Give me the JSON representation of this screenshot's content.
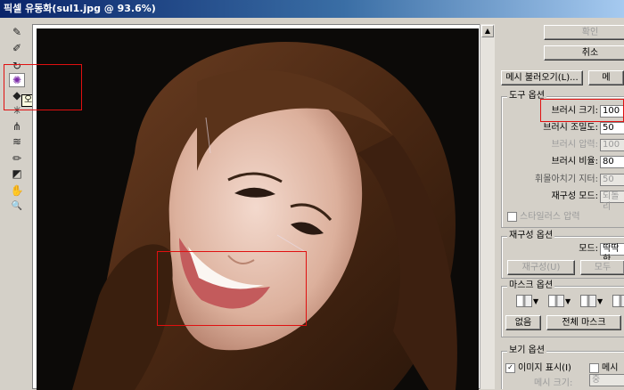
{
  "window": {
    "title": "픽셀 유동화(sul1.jpg @ 93.6%)"
  },
  "toolbar": {
    "tools": [
      {
        "icon": "forward-warp-icon",
        "glyph": "✎"
      },
      {
        "icon": "reconstruct-icon",
        "glyph": "✐"
      },
      {
        "icon": "twirl-icon",
        "glyph": "↻"
      },
      {
        "icon": "pucker-icon",
        "glyph": "✺"
      },
      {
        "icon": "bloat-icon",
        "glyph": "◆"
      },
      {
        "icon": "push-left-icon",
        "glyph": "✳"
      },
      {
        "icon": "mirror-icon",
        "glyph": "⋔"
      },
      {
        "icon": "turbulence-icon",
        "glyph": "≋"
      },
      {
        "icon": "freeze-mask-icon",
        "glyph": "✏"
      },
      {
        "icon": "thaw-mask-icon",
        "glyph": "◩"
      },
      {
        "icon": "hand-icon",
        "glyph": "✋"
      },
      {
        "icon": "zoom-icon",
        "glyph": "🔍"
      }
    ],
    "tooltip": "오목 도구(S)"
  },
  "panel": {
    "ok_label": "확인",
    "cancel_label": "취소",
    "load_mesh_label": "메시 불러오기(L)...",
    "save_mesh_label": "메",
    "tool_options": {
      "title": "도구 옵션",
      "rows": [
        {
          "label": "브러시 크기:",
          "value": "100",
          "disabled": false
        },
        {
          "label": "브러시 조밀도:",
          "value": "50",
          "disabled": false
        },
        {
          "label": "브러시 압력:",
          "value": "100",
          "disabled": true
        },
        {
          "label": "브러시 비율:",
          "value": "80",
          "disabled": false
        },
        {
          "label": "휘몰아치기 지터:",
          "value": "50",
          "disabled": true
        },
        {
          "label": "재구성 모드:",
          "value": "되돌리",
          "disabled": true
        }
      ],
      "stylus_label": "스타일러스 압력"
    },
    "reconstruct_options": {
      "title": "재구성 옵션",
      "mode_label": "모드:",
      "mode_value": "딱딱한",
      "reconstruct_button": "재구성(U)",
      "all_button": "모두"
    },
    "mask_options": {
      "title": "마스크 옵션",
      "none_button": "없음",
      "mask_all_button": "전체 마스크"
    },
    "view_options": {
      "title": "보기 옵션",
      "show_image_label": "이미지 표시(I)",
      "show_mesh_label": "메시",
      "mesh_size_label": "메시 크기:",
      "mesh_size_value": "중"
    }
  }
}
